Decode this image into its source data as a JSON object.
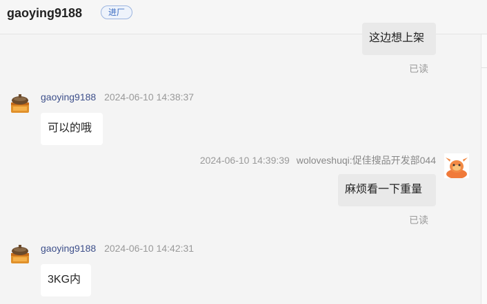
{
  "header": {
    "title": "gaoying9188",
    "badge": "进厂"
  },
  "messages": [
    {
      "text": "这边想上架",
      "read": "已读"
    },
    {
      "sender": "gaoying9188",
      "time": "2024-06-10 14:38:37",
      "text": "可以的哦"
    },
    {
      "time": "2024-06-10 14:39:39",
      "sender": "woloveshuqi:促佳搜品开发部044",
      "text": "麻烦看一下重量",
      "read": "已读"
    },
    {
      "sender": "gaoying9188",
      "time": "2024-06-10 14:42:31",
      "text": "3KG内"
    }
  ],
  "colors": {
    "background": "#f4f4f4",
    "incoming_bubble": "#ffffff",
    "outgoing_bubble": "#e9e9e9",
    "sender_name": "#3d4f8a",
    "badge": "#3b6cc2"
  },
  "icons": {
    "buyer_avatar": "treasure-chest-icon",
    "seller_avatar": "orange-mascot-icon"
  }
}
